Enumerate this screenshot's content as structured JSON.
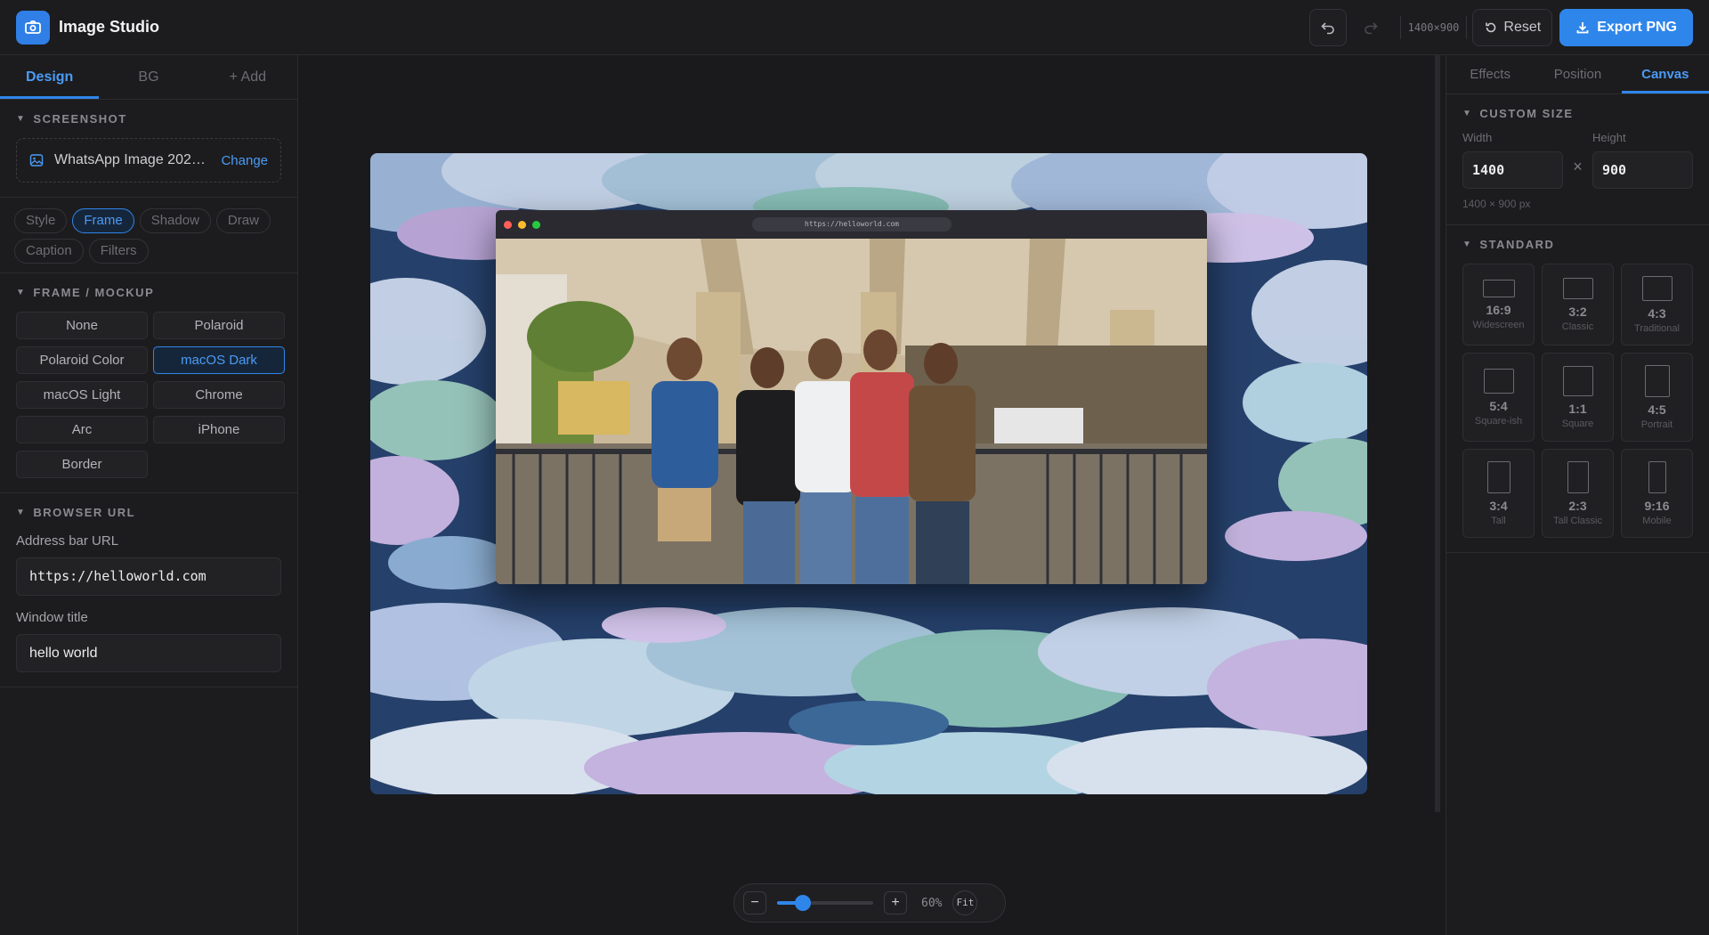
{
  "app": {
    "title": "Image Studio"
  },
  "toolbar": {
    "canvas_size": "1400×900",
    "reset_label": "Reset",
    "export_label": "Export PNG"
  },
  "left_tabs": [
    "Design",
    "BG",
    "+ Add"
  ],
  "screenshot_section": {
    "title": "SCREENSHOT",
    "file_name": "WhatsApp Image 202…",
    "change_label": "Change"
  },
  "tool_chips": [
    "Style",
    "Frame",
    "Shadow",
    "Draw",
    "Caption",
    "Filters"
  ],
  "frame_section": {
    "title": "FRAME / MOCKUP",
    "options": [
      "None",
      "Polaroid",
      "Polaroid Color",
      "macOS Dark",
      "macOS Light",
      "Chrome",
      "Arc",
      "iPhone",
      "Border"
    ],
    "selected": "macOS Dark"
  },
  "browser_url_section": {
    "title": "BROWSER URL",
    "url_label": "Address bar URL",
    "url_value": "https://helloworld.com",
    "window_title_label": "Window title",
    "window_title_value": "hello world"
  },
  "preview": {
    "url_bar": "https://helloworld.com"
  },
  "zoom": {
    "level": "60%",
    "fraction": 0.27,
    "fit_label": "Fit"
  },
  "right_tabs": [
    "Effects",
    "Position",
    "Canvas"
  ],
  "custom_size": {
    "title": "CUSTOM SIZE",
    "width_label": "Width",
    "width_value": "1400",
    "height_label": "Height",
    "height_value": "900",
    "summary": "1400 × 900 px"
  },
  "standard": {
    "title": "STANDARD",
    "ratios": [
      {
        "value": "16:9",
        "name": "Widescreen"
      },
      {
        "value": "3:2",
        "name": "Classic"
      },
      {
        "value": "4:3",
        "name": "Traditional"
      },
      {
        "value": "5:4",
        "name": "Square-ish"
      },
      {
        "value": "1:1",
        "name": "Square"
      },
      {
        "value": "4:5",
        "name": "Portrait"
      },
      {
        "value": "3:4",
        "name": "Tall"
      },
      {
        "value": "2:3",
        "name": "Tall Classic"
      },
      {
        "value": "9:16",
        "name": "Mobile"
      }
    ]
  },
  "colors": {
    "accent": "#2f86ea",
    "background": "#1a1a1c",
    "panel": "#1c1c1e",
    "sky": "#27406b"
  }
}
